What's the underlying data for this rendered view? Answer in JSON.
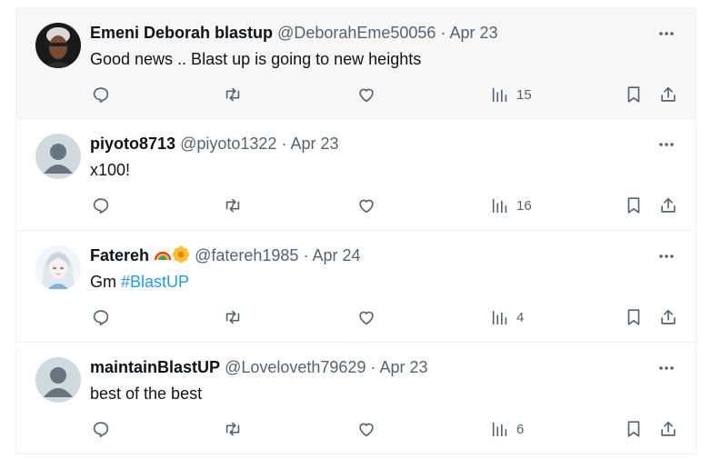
{
  "tweets": [
    {
      "name": "Emeni Deborah blastup",
      "handle": "@DeborahEme50056",
      "sep": "·",
      "date": "Apr 23",
      "text": "Good news .. Blast up is going to new heights",
      "hashtag": "",
      "views": "15",
      "avatar": "photo",
      "emojis": []
    },
    {
      "name": "piyoto8713",
      "handle": "@piyoto1322",
      "sep": "·",
      "date": "Apr 23",
      "text": "x100!",
      "hashtag": "",
      "views": "16",
      "avatar": "default",
      "emojis": []
    },
    {
      "name": "Fatereh",
      "handle": "@fatereh1985",
      "sep": "·",
      "date": "Apr 24",
      "text": "Gm ",
      "hashtag": "#BlastUP",
      "views": "4",
      "avatar": "drawing",
      "emojis": [
        "rainbow-icon",
        "flower-icon"
      ]
    },
    {
      "name": "maintainBlastUP",
      "handle": "@Loveloveth79629",
      "sep": "·",
      "date": "Apr 23",
      "text": "best of the best",
      "hashtag": "",
      "views": "6",
      "avatar": "default",
      "emojis": []
    }
  ],
  "colors": {
    "accent": "#1d9bf0",
    "muted": "#536471",
    "text": "#0f1419"
  }
}
